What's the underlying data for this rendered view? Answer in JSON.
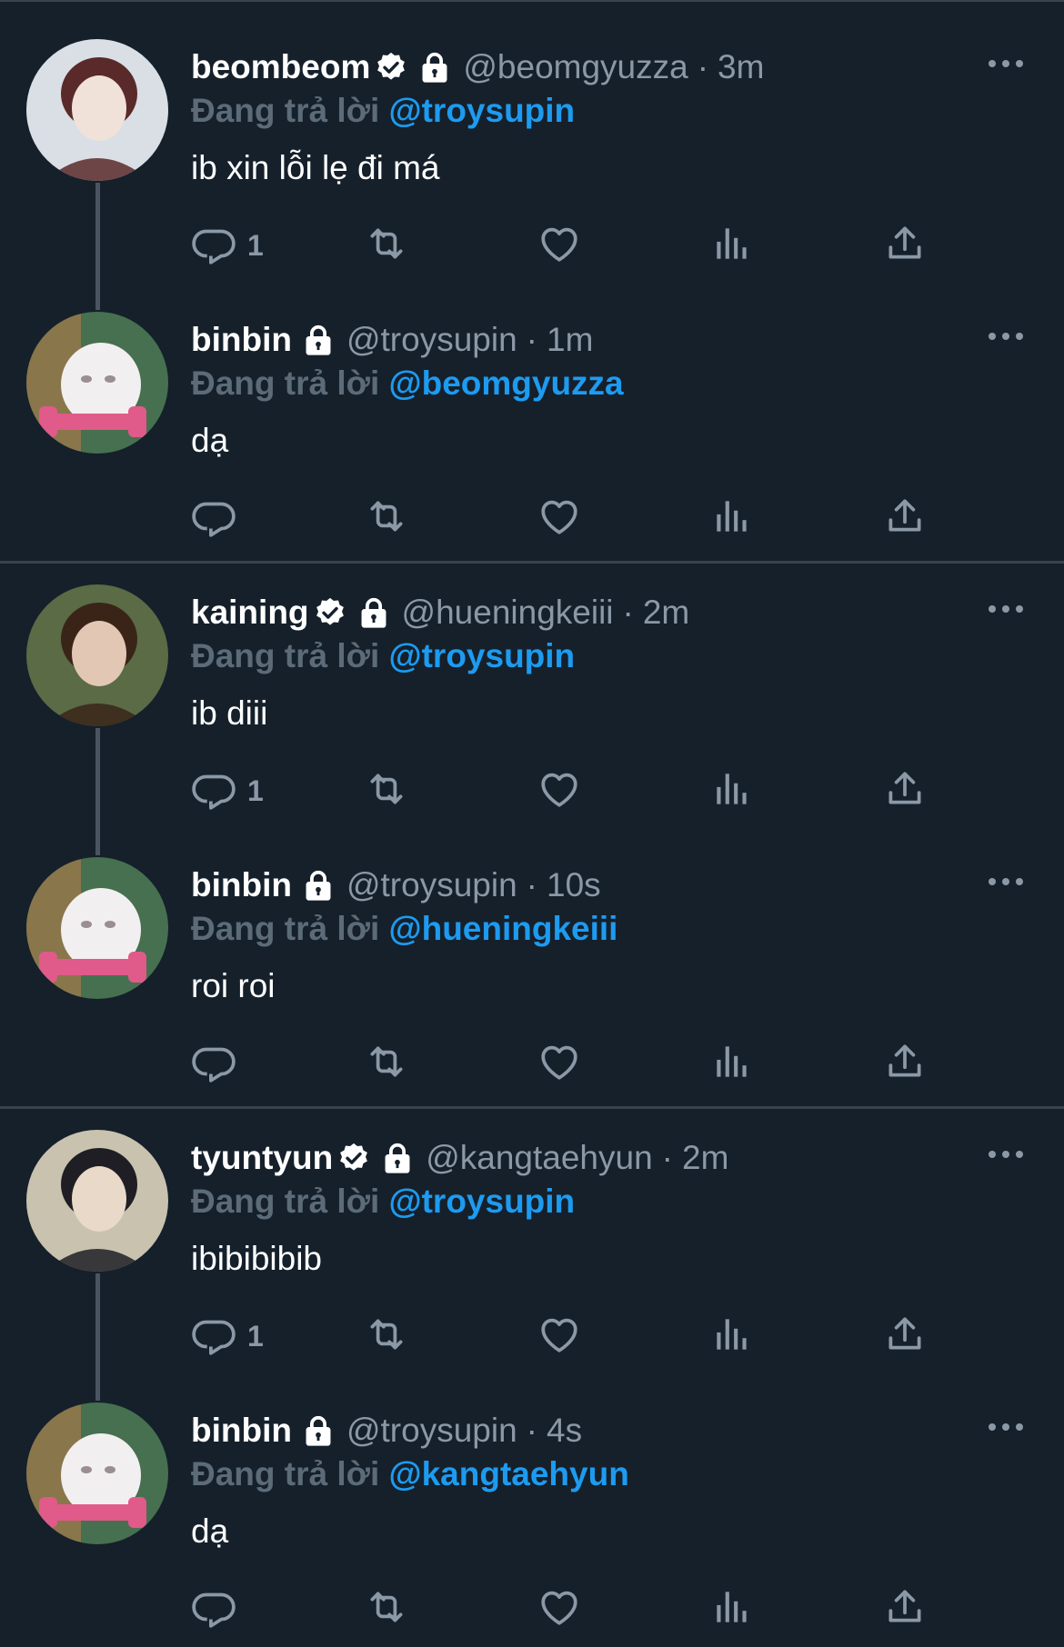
{
  "tweets": [
    {
      "name": "beombeom",
      "verified": true,
      "locked": true,
      "handle": "@beomgyuzza",
      "dot": "·",
      "time": "3m",
      "replying_label": "Đang trả lời",
      "replying_to": "@troysupin",
      "text": "ib xin lỗi lẹ đi má",
      "reply_count": "1",
      "avatar_colors": [
        "#d9dfe5",
        "#5a2a2a",
        "#f0e2d8"
      ]
    },
    {
      "name": "binbin",
      "verified": false,
      "locked": true,
      "handle": "@troysupin",
      "dot": "·",
      "time": "1m",
      "replying_label": "Đang trả lời",
      "replying_to": "@beomgyuzza",
      "text": "dạ",
      "reply_count": "",
      "avatar_colors": [
        "#46704f",
        "#f2eff0",
        "#e05a8a"
      ]
    },
    {
      "name": "kaining",
      "verified": true,
      "locked": true,
      "handle": "@hueningkeiii",
      "dot": "·",
      "time": "2m",
      "replying_label": "Đang trả lời",
      "replying_to": "@troysupin",
      "text": "ib diii",
      "reply_count": "1",
      "avatar_colors": [
        "#5a6b45",
        "#3a2418",
        "#e2c7b4"
      ]
    },
    {
      "name": "binbin",
      "verified": false,
      "locked": true,
      "handle": "@troysupin",
      "dot": "·",
      "time": "10s",
      "replying_label": "Đang trả lời",
      "replying_to": "@hueningkeiii",
      "text": "roi roi",
      "reply_count": "",
      "avatar_colors": [
        "#46704f",
        "#f2eff0",
        "#e05a8a"
      ]
    },
    {
      "name": "tyuntyun",
      "verified": true,
      "locked": true,
      "handle": "@kangtaehyun",
      "dot": "·",
      "time": "2m",
      "replying_label": "Đang trả lời",
      "replying_to": "@troysupin",
      "text": "ibibibibib",
      "reply_count": "1",
      "avatar_colors": [
        "#c9c2ae",
        "#1e1e24",
        "#e8d9c8"
      ]
    },
    {
      "name": "binbin",
      "verified": false,
      "locked": true,
      "handle": "@troysupin",
      "dot": "·",
      "time": "4s",
      "replying_label": "Đang trả lời",
      "replying_to": "@kangtaehyun",
      "text": "dạ",
      "reply_count": "",
      "avatar_colors": [
        "#46704f",
        "#f2eff0",
        "#e05a8a"
      ]
    }
  ],
  "icons": {
    "reply": "reply-icon",
    "retweet": "retweet-icon",
    "like": "heart-icon",
    "views": "views-icon",
    "share": "share-icon",
    "more": "more-icon",
    "verified": "verified-badge-icon",
    "lock": "lock-icon"
  },
  "colors": {
    "background": "#15202b",
    "divider": "#38444d",
    "secondary_text": "#8b98a5",
    "mention": "#1d9bf0",
    "replying_label": "#5c6b78",
    "thread_line": "#4a5561"
  }
}
